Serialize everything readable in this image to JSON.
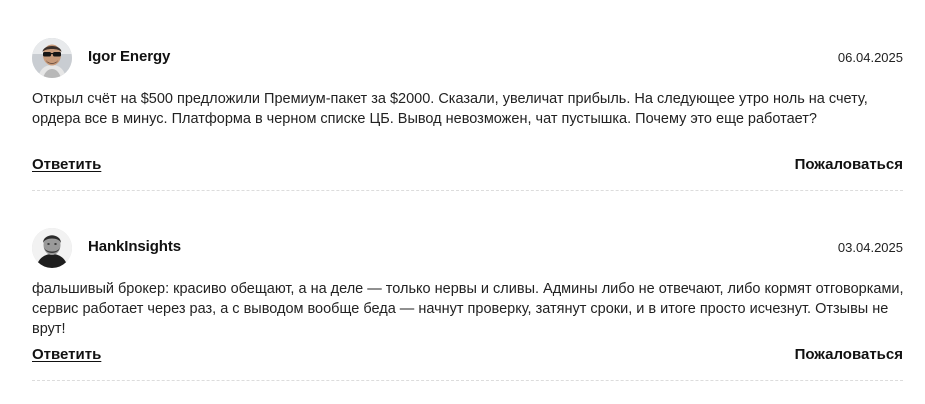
{
  "comments": [
    {
      "author": "Igor Energy",
      "date": "06.04.2025",
      "text": "Открыл счёт на $500 предложили Премиум-пакет за $2000. Сказали, увеличат прибыль. На следующее утро ноль на счету, ордера все в минус. Платформа в черном списке ЦБ. Вывод невозможен, чат пустышка. Почему это еще работает?",
      "reply_label": "Ответить",
      "report_label": "Пожаловаться",
      "avatar_icon": "user-avatar-sunglasses"
    },
    {
      "author": "HankInsights",
      "date": "03.04.2025",
      "text": "фальшивый брокер: красиво обещают, а на деле — только нервы и сливы. Админы либо не отвечают, либо кормят отговорками, сервис работает через раз, а с выводом вообще беда — начнут проверку, затянут сроки, и в итоге просто исчезнут. Отзывы не врут!",
      "reply_label": "Ответить",
      "report_label": "Пожаловаться",
      "avatar_icon": "user-avatar-bw-portrait"
    }
  ]
}
